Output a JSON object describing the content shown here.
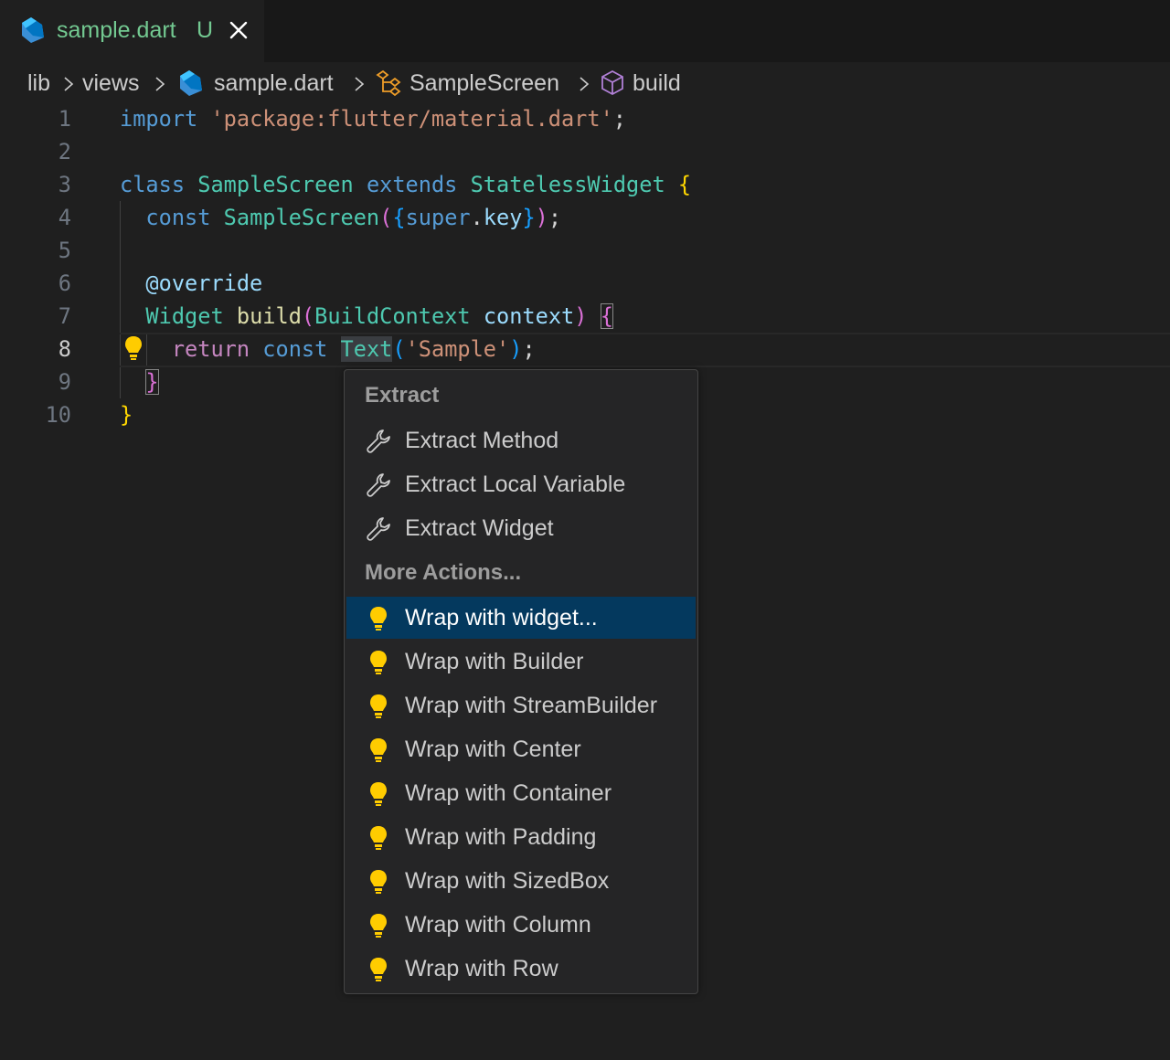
{
  "tab": {
    "title": "sample.dart",
    "status": "U",
    "icon": "dart-icon",
    "title_color": "#73c991"
  },
  "breadcrumb": {
    "items": [
      "lib",
      "views",
      "sample.dart",
      "SampleScreen",
      "build"
    ],
    "icons": [
      "",
      "",
      "dart-icon",
      "class-icon",
      "method-icon"
    ]
  },
  "editor": {
    "current_line": 8,
    "line_numbers": [
      "1",
      "2",
      "3",
      "4",
      "5",
      "6",
      "7",
      "8",
      "9",
      "10"
    ],
    "lines": [
      [
        [
          "kw",
          "import"
        ],
        [
          "punc",
          " "
        ],
        [
          "str",
          "'package:flutter/material.dart'"
        ],
        [
          "punc",
          ";"
        ]
      ],
      [],
      [
        [
          "kw",
          "class"
        ],
        [
          "punc",
          " "
        ],
        [
          "type",
          "SampleScreen"
        ],
        [
          "punc",
          " "
        ],
        [
          "kw",
          "extends"
        ],
        [
          "punc",
          " "
        ],
        [
          "type",
          "StatelessWidget"
        ],
        [
          "punc",
          " "
        ],
        [
          "b1",
          "{"
        ]
      ],
      [
        [
          "punc",
          "  "
        ],
        [
          "kw",
          "const"
        ],
        [
          "punc",
          " "
        ],
        [
          "type",
          "SampleScreen"
        ],
        [
          "b2",
          "("
        ],
        [
          "b3",
          "{"
        ],
        [
          "kw",
          "super"
        ],
        [
          "punc",
          "."
        ],
        [
          "var",
          "key"
        ],
        [
          "b3",
          "}"
        ],
        [
          "b2",
          ")"
        ],
        [
          "punc",
          ";"
        ]
      ],
      [],
      [
        [
          "punc",
          "  "
        ],
        [
          "var",
          "@override"
        ]
      ],
      [
        [
          "punc",
          "  "
        ],
        [
          "type",
          "Widget"
        ],
        [
          "punc",
          " "
        ],
        [
          "fn",
          "build"
        ],
        [
          "b2",
          "("
        ],
        [
          "type",
          "BuildContext"
        ],
        [
          "punc",
          " "
        ],
        [
          "var",
          "context"
        ],
        [
          "b2",
          ")"
        ],
        [
          "punc",
          " "
        ],
        [
          "b2 match-brace",
          "{"
        ]
      ],
      [
        [
          "punc",
          "    "
        ],
        [
          "ctl",
          "return"
        ],
        [
          "punc",
          " "
        ],
        [
          "kw",
          "const"
        ],
        [
          "punc",
          " "
        ],
        [
          "type sel-word",
          "Text"
        ],
        [
          "b3",
          "("
        ],
        [
          "str",
          "'Sample'"
        ],
        [
          "b3",
          ")"
        ],
        [
          "punc",
          ";"
        ]
      ],
      [
        [
          "punc",
          "  "
        ],
        [
          "b2 match-brace",
          "}"
        ]
      ],
      [
        [
          "b1",
          "}"
        ]
      ]
    ]
  },
  "menu": {
    "sections": [
      {
        "header": "Extract",
        "items": [
          {
            "label": "Extract Method",
            "icon": "wrench-icon"
          },
          {
            "label": "Extract Local Variable",
            "icon": "wrench-icon"
          },
          {
            "label": "Extract Widget",
            "icon": "wrench-icon"
          }
        ]
      },
      {
        "header": "More Actions...",
        "items": [
          {
            "label": "Wrap with widget...",
            "icon": "lightbulb-icon",
            "active": true
          },
          {
            "label": "Wrap with Builder",
            "icon": "lightbulb-icon"
          },
          {
            "label": "Wrap with StreamBuilder",
            "icon": "lightbulb-icon"
          },
          {
            "label": "Wrap with Center",
            "icon": "lightbulb-icon"
          },
          {
            "label": "Wrap with Container",
            "icon": "lightbulb-icon"
          },
          {
            "label": "Wrap with Padding",
            "icon": "lightbulb-icon"
          },
          {
            "label": "Wrap with SizedBox",
            "icon": "lightbulb-icon"
          },
          {
            "label": "Wrap with Column",
            "icon": "lightbulb-icon"
          },
          {
            "label": "Wrap with Row",
            "icon": "lightbulb-icon"
          }
        ]
      }
    ]
  },
  "colors": {
    "background": "#1f1f1f",
    "active_item": "#04395e",
    "lightbulb": "#ffcc00"
  }
}
